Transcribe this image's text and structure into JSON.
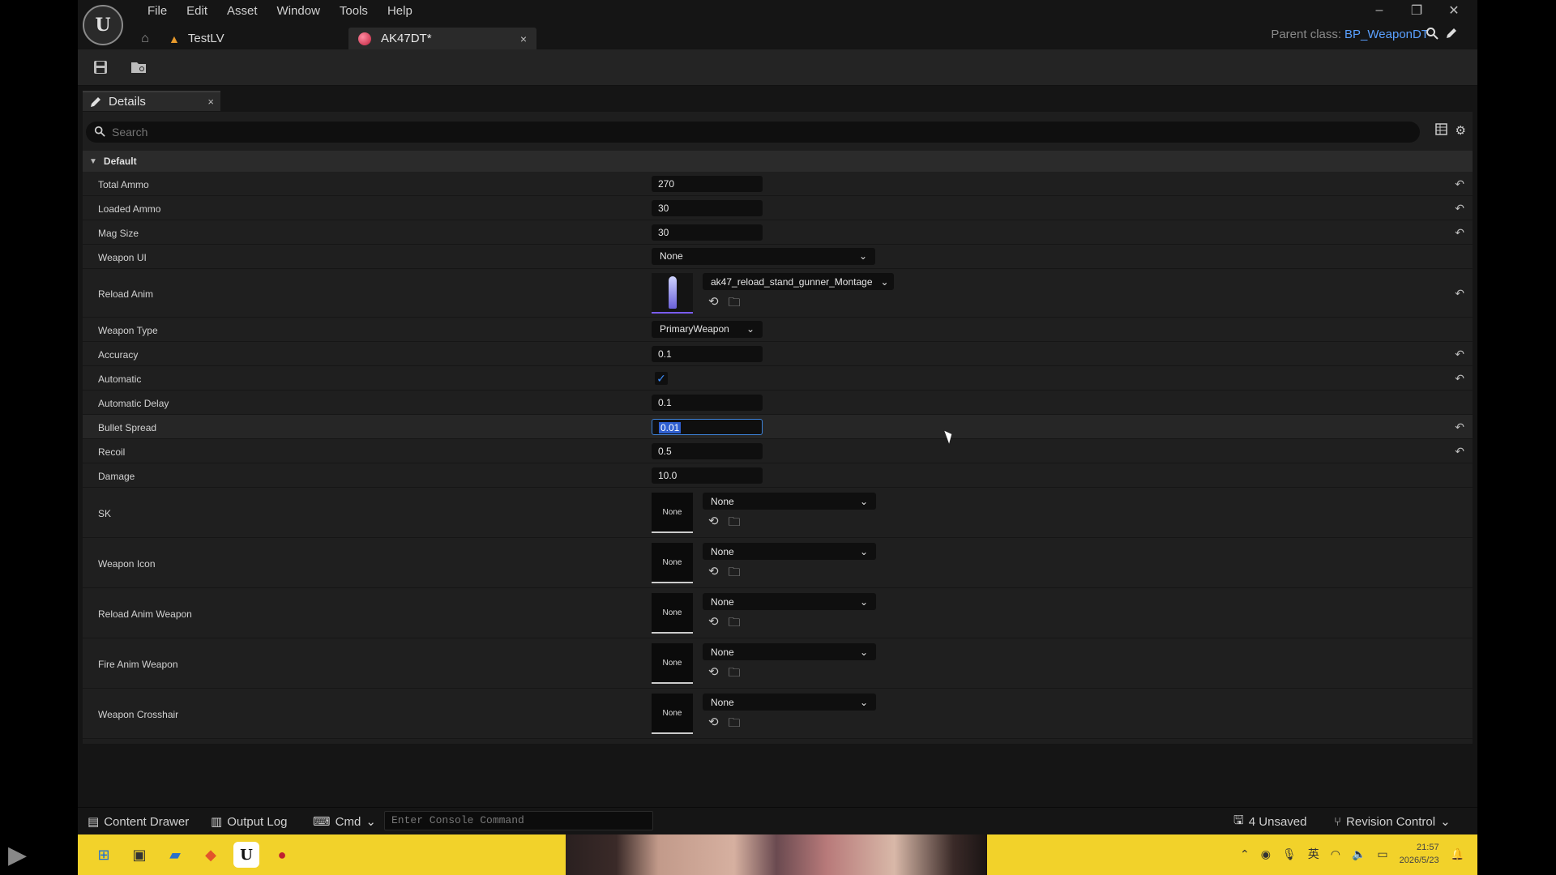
{
  "menu": [
    "File",
    "Edit",
    "Asset",
    "Window",
    "Tools",
    "Help"
  ],
  "tabs": {
    "level": "TestLV",
    "active": "AK47DT*",
    "close": "×"
  },
  "parent_class": {
    "label": "Parent class:",
    "value": "BP_WeaponDT"
  },
  "window_controls": {
    "minimize": "–",
    "maximize": "❐",
    "close": "✕"
  },
  "details": {
    "tab_label": "Details",
    "close": "×",
    "search_placeholder": "Search",
    "category": "Default"
  },
  "properties": [
    {
      "label": "Total Ammo",
      "value": "270"
    },
    {
      "label": "Loaded Ammo",
      "value": "30"
    },
    {
      "label": "Mag Size",
      "value": "30"
    },
    {
      "label": "Weapon UI",
      "value": "None"
    },
    {
      "label": "Reload Anim",
      "value": "ak47_reload_stand_gunner_Montage"
    },
    {
      "label": "Weapon Type",
      "value": "PrimaryWeapon"
    },
    {
      "label": "Accuracy",
      "value": "0.1"
    },
    {
      "label": "Automatic",
      "value": true
    },
    {
      "label": "Automatic Delay",
      "value": "0.1"
    },
    {
      "label": "Bullet Spread",
      "value": "0.01"
    },
    {
      "label": "Recoil",
      "value": "0.5"
    },
    {
      "label": "Damage",
      "value": "10.0"
    },
    {
      "label": "SK",
      "value": "None",
      "thumb": "None"
    },
    {
      "label": "Weapon Icon",
      "value": "None",
      "thumb": "None"
    },
    {
      "label": "Reload Anim Weapon",
      "value": "None",
      "thumb": "None"
    },
    {
      "label": "Fire Anim Weapon",
      "value": "None",
      "thumb": "None"
    },
    {
      "label": "Weapon Crosshair",
      "value": "None",
      "thumb": "None"
    }
  ],
  "bottom_bar": {
    "content_drawer": "Content Drawer",
    "output_log": "Output Log",
    "cmd": "Cmd",
    "console_placeholder": "Enter Console Command",
    "unsaved": "4 Unsaved",
    "revision_control": "Revision Control"
  },
  "taskbar": {
    "time": "21:57",
    "date": "2026/5/23",
    "ime": "英"
  },
  "colors": {
    "accent_blue": "#5aa0ff",
    "selection": "#2f5fd0",
    "taskbar": "#f2d22a"
  }
}
